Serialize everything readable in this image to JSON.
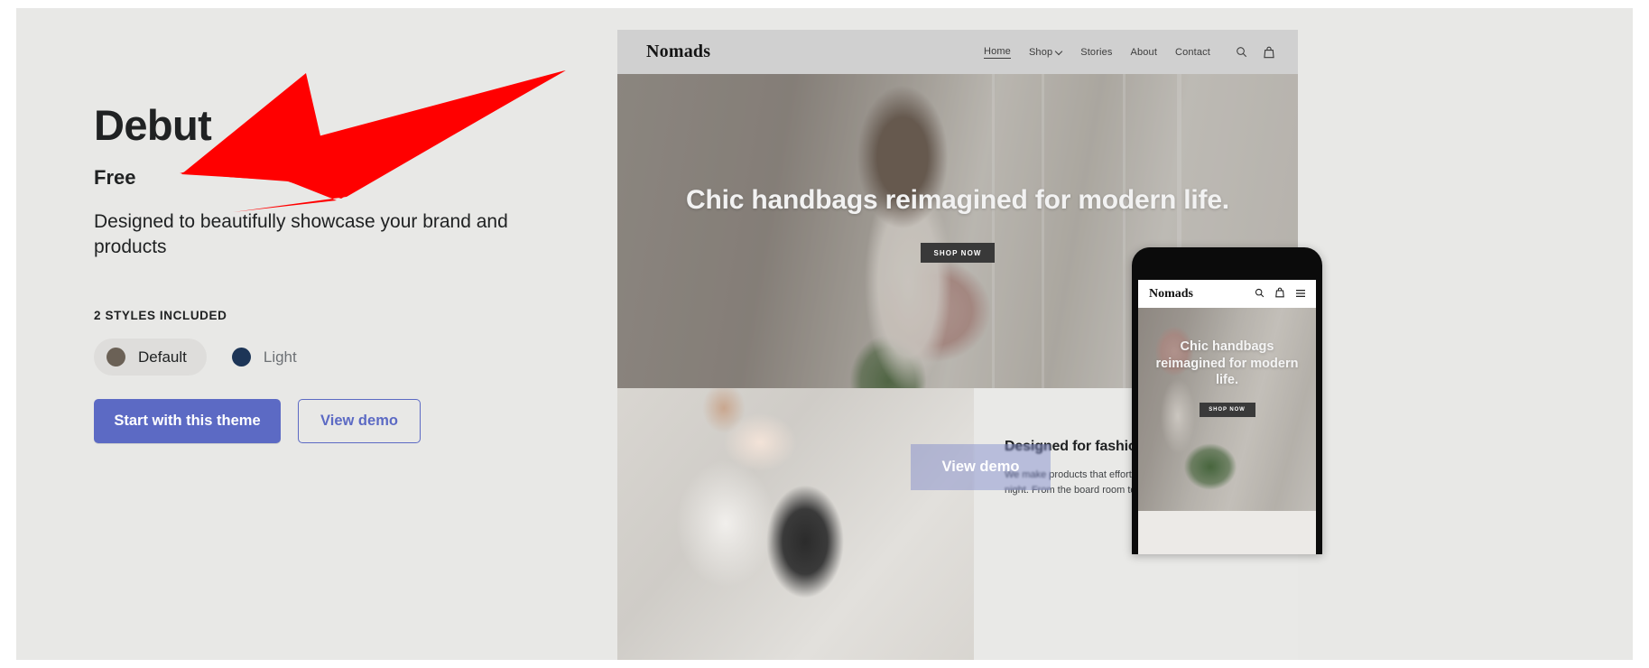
{
  "theme": {
    "title": "Debut",
    "price": "Free",
    "description": "Designed to beautifully showcase your brand and products",
    "styles_label": "2 STYLES INCLUDED",
    "styles": [
      {
        "name": "Default",
        "color": "#6b6156",
        "selected": true
      },
      {
        "name": "Light",
        "color": "#1d3557",
        "selected": false
      }
    ],
    "primary_button": "Start with this theme",
    "secondary_button": "View demo",
    "accent_color": "#5c6ac4",
    "text_color": "#202223",
    "page_background": "#e8e8e6"
  },
  "preview": {
    "store_name": "Nomads",
    "nav": [
      {
        "label": "Home",
        "active": true,
        "has_chevron": false
      },
      {
        "label": "Shop",
        "active": false,
        "has_chevron": true
      },
      {
        "label": "Stories",
        "active": false,
        "has_chevron": false
      },
      {
        "label": "About",
        "active": false,
        "has_chevron": false
      },
      {
        "label": "Contact",
        "active": false,
        "has_chevron": false
      }
    ],
    "header_icons": [
      "search-icon",
      "shopping-bag-icon"
    ],
    "hero": {
      "heading": "Chic handbags reimagined for modern life.",
      "button": "SHOP NOW"
    },
    "lower_section": {
      "heading": "Designed for fashion. Crafted for life.",
      "body": "We make products that effortlessly transition from day to night. From the board room to the fitness studio."
    },
    "overlay_button": "View demo"
  },
  "mobile_preview": {
    "store_name": "Nomads",
    "header_icons": [
      "search-icon",
      "shopping-bag-icon",
      "hamburger-menu-icon"
    ],
    "hero": {
      "heading": "Chic handbags reimagined for modern life.",
      "button": "SHOP NOW"
    }
  },
  "annotation": {
    "type": "arrow",
    "color": "#ff0000",
    "points_to": "Debut theme title"
  }
}
